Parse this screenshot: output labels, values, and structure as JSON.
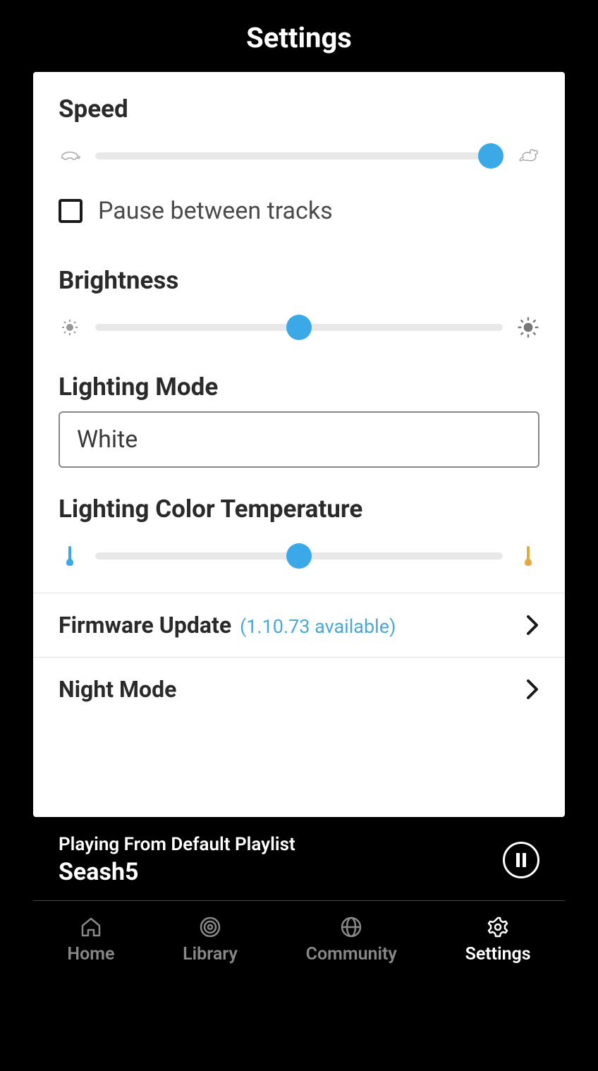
{
  "header": {
    "title": "Settings"
  },
  "speed": {
    "label": "Speed",
    "value_pct": 97
  },
  "pause_tracks": {
    "label": "Pause between tracks",
    "checked": false
  },
  "brightness": {
    "label": "Brightness",
    "value_pct": 50
  },
  "lighting_mode": {
    "label": "Lighting Mode",
    "value": "White"
  },
  "color_temp": {
    "label": "Lighting Color Temperature",
    "value_pct": 50
  },
  "firmware": {
    "label": "Firmware Update",
    "sub": "(1.10.73 available)"
  },
  "night_mode": {
    "label": "Night Mode"
  },
  "now_playing": {
    "sub": "Playing From Default Playlist",
    "title": "Seash5"
  },
  "tabs": {
    "home": "Home",
    "library": "Library",
    "community": "Community",
    "settings": "Settings"
  }
}
